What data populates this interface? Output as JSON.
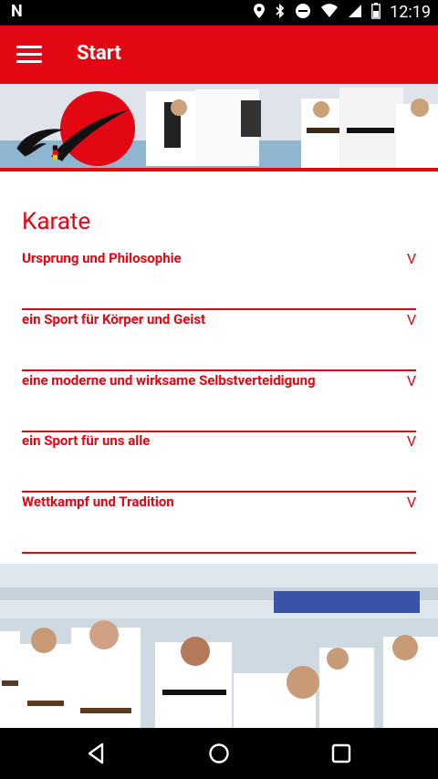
{
  "status_bar": {
    "time": "12:19",
    "icons": [
      "n-notification-icon",
      "location-icon",
      "bluetooth-icon",
      "do-not-disturb-icon",
      "wifi-icon",
      "signal-icon",
      "battery-icon"
    ]
  },
  "app_bar": {
    "title": "Start",
    "menu_icon": "hamburger-menu-icon"
  },
  "hero": {
    "logo": "organization-logo"
  },
  "section": {
    "title": "Karate",
    "items": [
      {
        "label": "Ursprung und Philosophie",
        "chevron": "V"
      },
      {
        "label": "ein Sport für Körper und Geist",
        "chevron": "V"
      },
      {
        "label": "eine moderne und wirksame Selbstverteidigung",
        "chevron": "V"
      },
      {
        "label": "ein Sport für uns alle",
        "chevron": "V"
      },
      {
        "label": "Wettkampf und Tradition",
        "chevron": "V"
      }
    ]
  },
  "photo": {
    "subject": "karate-training-group-photo"
  },
  "nav_bar": {
    "buttons": [
      "back-icon",
      "home-icon",
      "recent-apps-icon"
    ]
  },
  "colors": {
    "accent": "#e30613",
    "status_bar": "#000000",
    "nav_bar": "#000000",
    "background": "#ffffff"
  }
}
